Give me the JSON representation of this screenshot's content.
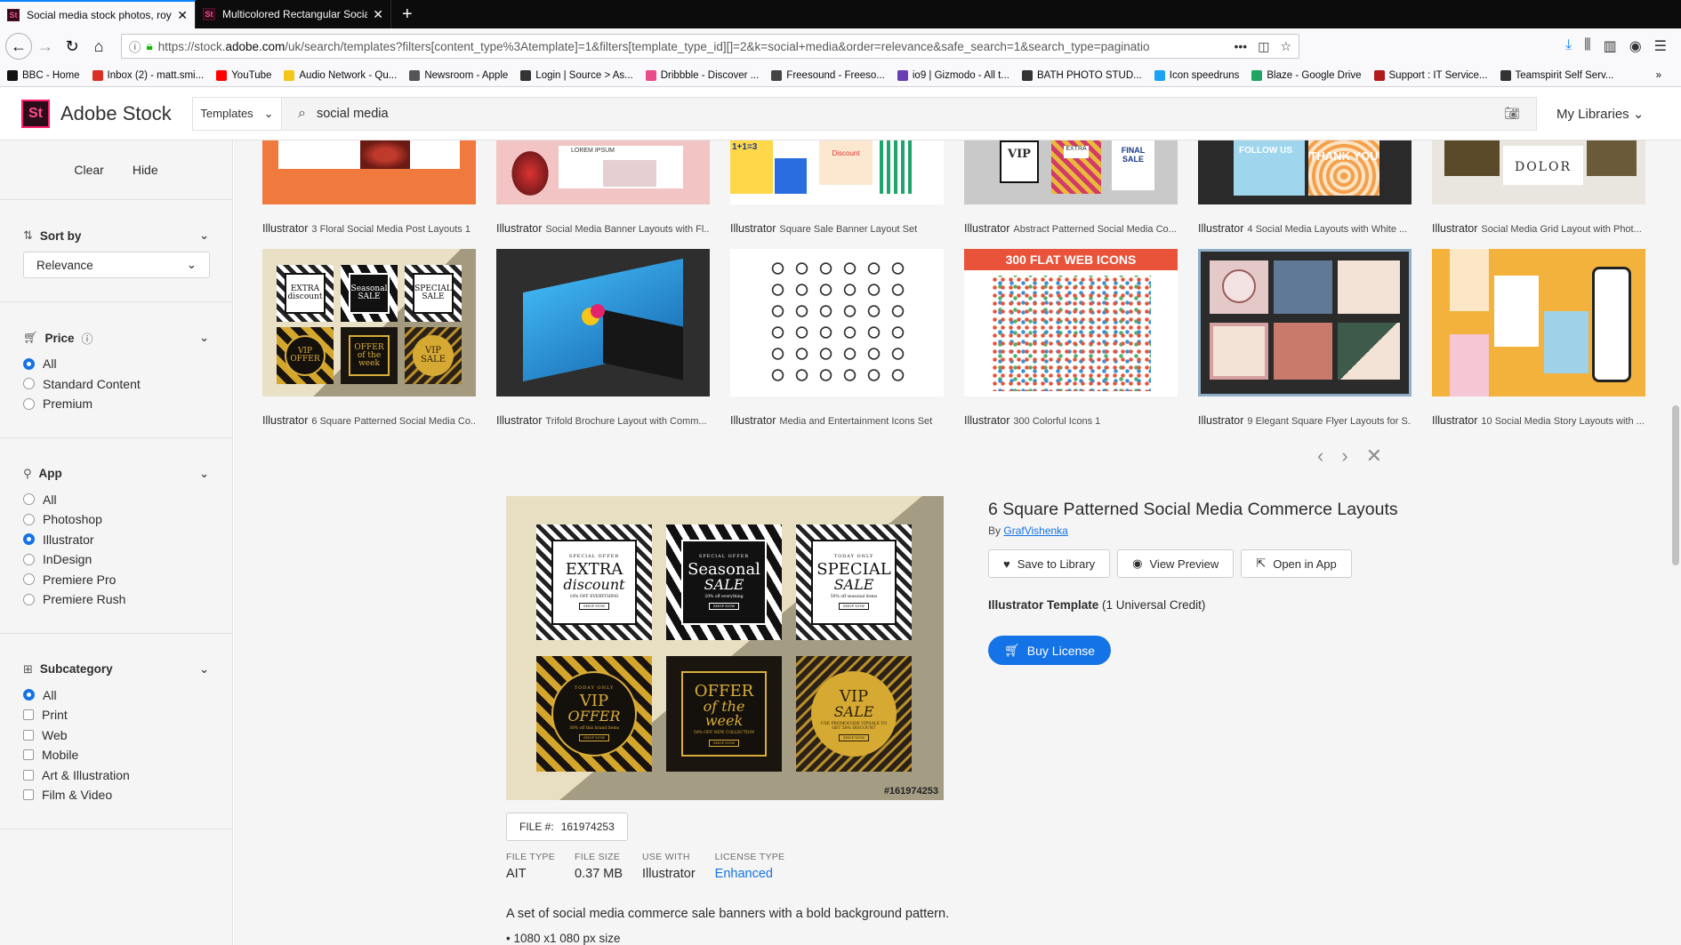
{
  "browser": {
    "tabs": [
      {
        "label": "Social media stock photos, royalt",
        "active": true
      },
      {
        "label": "Multicolored Rectangular Social",
        "active": false
      }
    ],
    "url_prefix": "https://stock.",
    "url_domain": "adobe.com",
    "url_rest": "/uk/search/templates?filters[content_type%3Atemplate]=1&filters[template_type_id][]=2&k=social+media&order=relevance&safe_search=1&search_type=paginatio",
    "bookmarks": [
      {
        "label": "BBC - Home",
        "color": "#111111"
      },
      {
        "label": "Inbox (2) - matt.smi...",
        "color": "#d93025"
      },
      {
        "label": "YouTube",
        "color": "#ff0000"
      },
      {
        "label": "Audio Network - Qu...",
        "color": "#f5c518"
      },
      {
        "label": "Newsroom - Apple",
        "color": "#555555"
      },
      {
        "label": "Login | Source > As...",
        "color": "#333333"
      },
      {
        "label": "Dribbble - Discover ...",
        "color": "#ea4c89"
      },
      {
        "label": "Freesound - Freeso...",
        "color": "#444444"
      },
      {
        "label": "io9 | Gizmodo - All t...",
        "color": "#6a3fb5"
      },
      {
        "label": "BATH PHOTO STUD...",
        "color": "#333333"
      },
      {
        "label": "Icon speedruns",
        "color": "#1da1f2"
      },
      {
        "label": "Blaze - Google Drive",
        "color": "#1fa463"
      },
      {
        "label": "Support : IT Service...",
        "color": "#b31b1b"
      },
      {
        "label": "Teamspirit Self Serv...",
        "color": "#333333"
      }
    ]
  },
  "header": {
    "logo_badge": "St",
    "logo_text": "Adobe Stock",
    "type_select": "Templates",
    "search_value": "social media",
    "my_libraries": "My Libraries"
  },
  "sidebar": {
    "clear": "Clear",
    "hide": "Hide",
    "sort": {
      "title": "Sort by",
      "value": "Relevance"
    },
    "price": {
      "title": "Price",
      "options": [
        {
          "label": "All",
          "on": true
        },
        {
          "label": "Standard Content",
          "on": false
        },
        {
          "label": "Premium",
          "on": false
        }
      ]
    },
    "app": {
      "title": "App",
      "options": [
        {
          "label": "All",
          "on": false
        },
        {
          "label": "Photoshop",
          "on": false
        },
        {
          "label": "Illustrator",
          "on": true
        },
        {
          "label": "InDesign",
          "on": false
        },
        {
          "label": "Premiere Pro",
          "on": false
        },
        {
          "label": "Premiere Rush",
          "on": false
        }
      ]
    },
    "subcategory": {
      "title": "Subcategory",
      "options": [
        {
          "label": "All",
          "on": true
        },
        {
          "label": "Print",
          "on": false
        },
        {
          "label": "Web",
          "on": false
        },
        {
          "label": "Mobile",
          "on": false
        },
        {
          "label": "Art & Illustration",
          "on": false
        },
        {
          "label": "Film & Video",
          "on": false
        }
      ]
    }
  },
  "results": {
    "row1": [
      {
        "app": "Illustrator",
        "title": "3 Floral Social Media Post Layouts 1"
      },
      {
        "app": "Illustrator",
        "title": "Social Media Banner Layouts with Fl..."
      },
      {
        "app": "Illustrator",
        "title": "Square Sale Banner Layout Set"
      },
      {
        "app": "Illustrator",
        "title": "Abstract Patterned Social Media Co..."
      },
      {
        "app": "Illustrator",
        "title": "4 Social Media Layouts with White ..."
      },
      {
        "app": "Illustrator",
        "title": "Social Media Grid Layout with Phot..."
      }
    ],
    "row1_text": {
      "lorem": "LOREM IPSUM",
      "discount": "Discount",
      "vip": "VIP",
      "sale": "SALE",
      "extra": "EXTRA",
      "final_sale": "FINAL SALE",
      "follow_us": "FOLLOW US",
      "thank_you": "THANK YOU",
      "dolor": "DOLOR",
      "lorem_ipsum": "LOREM IPSUM",
      "nums": "1+1=3"
    },
    "row2": [
      {
        "app": "Illustrator",
        "title": "6 Square Patterned Social Media Co..."
      },
      {
        "app": "Illustrator",
        "title": "Trifold Brochure Layout with Comm..."
      },
      {
        "app": "Illustrator",
        "title": "Media and Entertainment Icons Set"
      },
      {
        "app": "Illustrator",
        "title": "300 Colorful Icons 1"
      },
      {
        "app": "Illustrator",
        "title": "9 Elegant Square Flyer Layouts for S..."
      },
      {
        "app": "Illustrator",
        "title": "10 Social Media Story Layouts with ..."
      }
    ],
    "web_icons_banner": "300 FLAT WEB ICONS"
  },
  "detail": {
    "title": "6 Square Patterned Social Media Commerce Layouts",
    "by_prefix": "By",
    "author": "GrafVishenka",
    "save_label": "Save to Library",
    "preview_label": "View Preview",
    "open_label": "Open in App",
    "template_type": "Illustrator Template",
    "credit": "(1 Universal Credit)",
    "buy_label": "Buy License",
    "file_no_label": "FILE #:",
    "file_no": "161974253",
    "watermark_id": "#161974253",
    "meta": [
      {
        "key": "FILE TYPE",
        "value": "AIT",
        "link": false
      },
      {
        "key": "FILE SIZE",
        "value": "0.37 MB",
        "link": false
      },
      {
        "key": "USE WITH",
        "value": "Illustrator",
        "link": false
      },
      {
        "key": "LICENSE TYPE",
        "value": "Enhanced",
        "link": true
      }
    ],
    "description": "A set of social media commerce sale banners with a bold background pattern.",
    "bullet": "1080 x1 080 px size",
    "tiles": [
      {
        "top": "SPECIAL OFFER",
        "main": "EXTRA",
        "sub": "discount",
        "small": "10% OFF EVERYTHING"
      },
      {
        "top": "SPECIAL OFFER",
        "main": "Seasonal",
        "sub": "SALE",
        "small": "20% off everything"
      },
      {
        "top": "TODAY ONLY",
        "main": "SPECIAL",
        "sub": "SALE",
        "small": "50% off seasonal items"
      },
      {
        "top": "TODAY ONLY",
        "main": "VIP",
        "sub": "OFFER",
        "small": "30% off this brand items"
      },
      {
        "top": "",
        "main": "OFFER",
        "sub": "of the week",
        "small": "50% OFF NEW COLLECTION"
      },
      {
        "top": "",
        "main": "VIP",
        "sub": "SALE",
        "small": "USE PROMOCODE VIPSALE TO GET 50% DISCOUNT"
      }
    ],
    "shop_now": "SHOP NOW"
  },
  "colors": {
    "accent": "#1473e6",
    "stock_brand": "#ff1f6f",
    "gold": "#d6aa32"
  }
}
